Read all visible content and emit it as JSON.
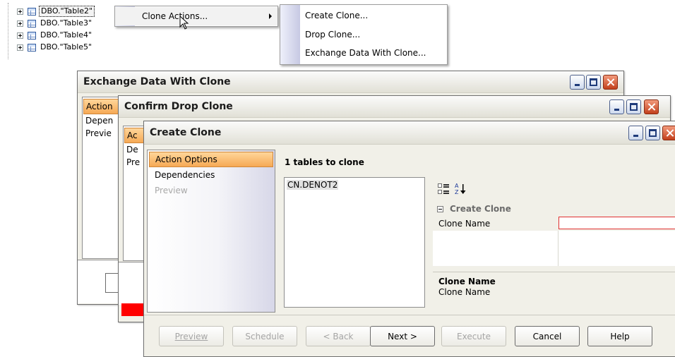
{
  "tree": {
    "items": [
      {
        "label": "DBO.\"Table2\"",
        "selected": true
      },
      {
        "label": "DBO.\"Table3\"",
        "selected": false
      },
      {
        "label": "DBO.\"Table4\"",
        "selected": false
      },
      {
        "label": "DBO.\"Table5\"",
        "selected": false
      }
    ]
  },
  "context_menu": {
    "clone_actions": "Clone Actions..."
  },
  "submenu": {
    "create_clone": "Create Clone...",
    "drop_clone": "Drop Clone...",
    "exchange_data": "Exchange Data With Clone..."
  },
  "exchange_window": {
    "title": "Exchange Data With Clone",
    "nav": [
      "Action",
      "Depen",
      "Previe"
    ]
  },
  "confirm_window": {
    "title": "Confirm Drop Clone",
    "nav": [
      "Ac",
      "De",
      "Pre"
    ]
  },
  "create_window": {
    "title": "Create Clone",
    "nav": {
      "action_options": "Action Options",
      "dependencies": "Dependencies",
      "preview": "Preview"
    },
    "tables_heading": "1 tables to clone",
    "table_list": [
      "CN.DENOT2"
    ],
    "properties": {
      "category": "Create Clone",
      "row_label": "Clone Name",
      "row_value": "",
      "desc_title": "Clone Name",
      "desc_text": "Clone Name"
    },
    "buttons": {
      "preview": "Preview",
      "schedule": "Schedule",
      "back": "< Back",
      "next": "Next >",
      "execute": "Execute",
      "cancel": "Cancel",
      "help": "Help"
    }
  },
  "colors": {
    "nav_active": "#f6a955",
    "error_bar": "#ff0000",
    "required_border": "#e03030"
  }
}
